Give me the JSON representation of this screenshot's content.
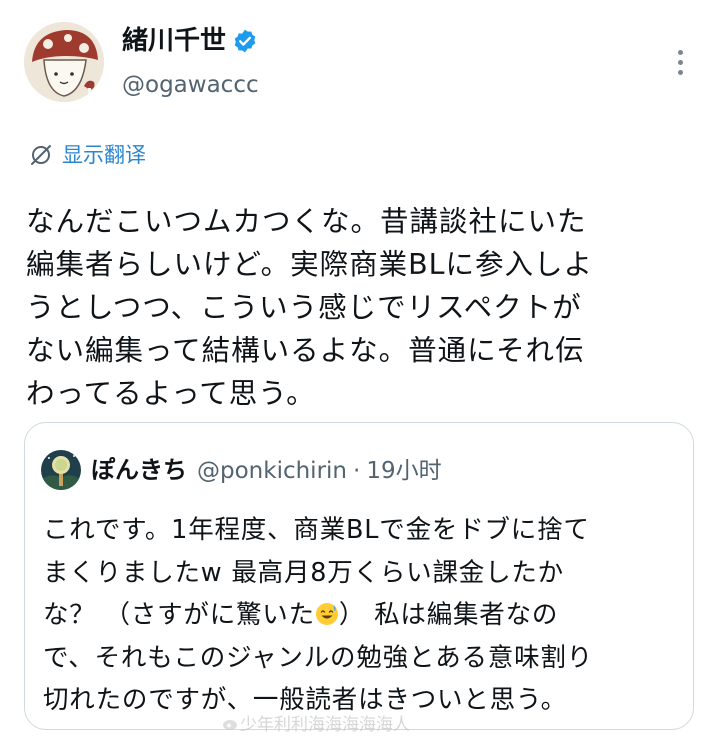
{
  "author": {
    "display_name": "緒川千世",
    "handle": "@ogawaccc",
    "avatar_icon": "mushroom-character-avatar",
    "verified_icon": "verified-badge-icon",
    "verified_color": "#1d9bf0"
  },
  "translate": {
    "label": "显示翻译",
    "icon": "translate-icon",
    "color": "#2b86cf"
  },
  "tweet": {
    "lines": [
      "なんだこいつムカつくな。昔講談社にいた",
      "編集者らしいけど。実際商業BLに参入しよ",
      "うとしつつ、こういう感じでリスペクトが",
      "ない編集って結構いるよな。普通にそれ伝",
      "わってるよって思う。"
    ]
  },
  "quoted": {
    "avatar_icon": "night-landscape-avatar",
    "name": "ぽんきち",
    "handle": "@ponkichirin",
    "separator": "·",
    "time": "19小时",
    "lines": [
      "これです。1年程度、商業BLで金をドブに捨て",
      "まくりましたw  最高月8万くらい課金したか",
      "な？ （さすがに驚いた",
      "で、それもこのジャンルの勉強とある意味割り",
      "切れたのですが、一般読者はきついと思う。"
    ],
    "line3_after_emoji": "）  私は編集者なの",
    "emoji_icon": "sweat-smile-emoji"
  },
  "watermark": {
    "text": "少年利利海海海海海人"
  }
}
